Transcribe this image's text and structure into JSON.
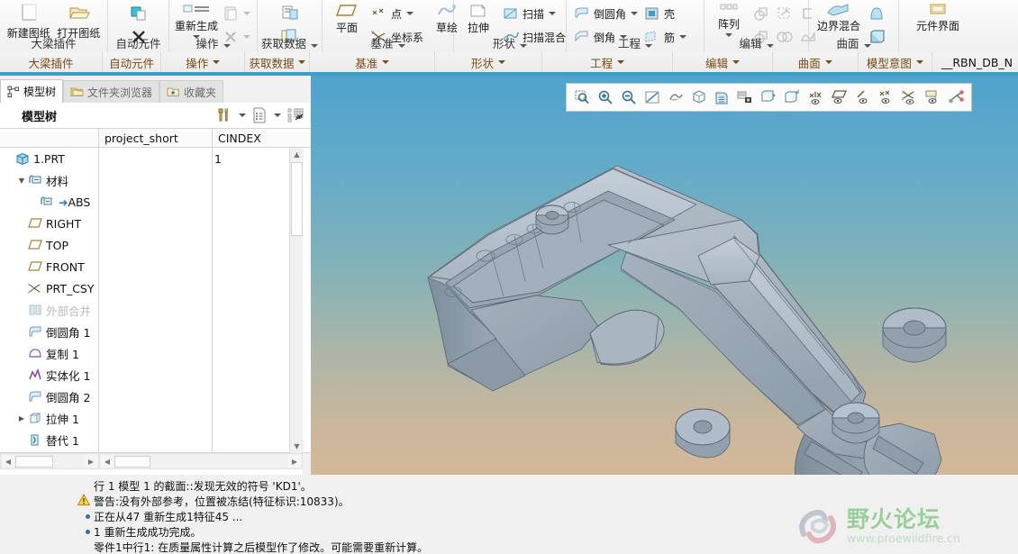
{
  "ribbon": {
    "groups": [
      {
        "name": "beam-plugin",
        "label": "大梁插件",
        "has_caret": false,
        "buttons": [
          {
            "name": "new-drawing",
            "label": "新建图纸",
            "icon": "new-sheet-icon"
          },
          {
            "name": "open-drawing",
            "label": "打开图纸",
            "icon": "open-sheet-icon"
          }
        ]
      },
      {
        "name": "auto-component",
        "label": "自动元件",
        "has_caret": false,
        "buttons": [
          {
            "name": "auto-create",
            "label": "",
            "icon": "auto-component-icon"
          },
          {
            "name": "auto-delete",
            "label": "",
            "icon": "x-icon"
          }
        ]
      },
      {
        "name": "operations",
        "label": "操作",
        "has_caret": true,
        "buttons": [
          {
            "name": "regenerate",
            "label": "重新生成",
            "icon": "regenerate-icon"
          },
          {
            "name": "paste",
            "label": "",
            "icon": "paste-icon"
          },
          {
            "name": "delete",
            "label": "",
            "icon": "x-icon"
          }
        ]
      },
      {
        "name": "get-data",
        "label": "获取数据",
        "has_caret": true,
        "buttons": [
          {
            "name": "import-data",
            "label": "",
            "icon": "import-icon"
          },
          {
            "name": "merge-data",
            "label": "",
            "icon": "merge-icon"
          }
        ]
      },
      {
        "name": "datum",
        "label": "基准",
        "has_caret": true,
        "buttons": [
          {
            "name": "plane",
            "label": "平面",
            "icon": "datum-plane-icon"
          },
          {
            "name": "point",
            "label": "点",
            "icon": "datum-point-icon"
          },
          {
            "name": "coordinate-system",
            "label": "坐标系",
            "icon": "csys-icon"
          },
          {
            "name": "sketch",
            "label": "草绘",
            "icon": "sketch-icon"
          }
        ]
      },
      {
        "name": "shapes",
        "label": "形状",
        "has_caret": true,
        "buttons": [
          {
            "name": "extrude",
            "label": "拉伸",
            "icon": "extrude-icon"
          },
          {
            "name": "sweep",
            "label": "扫描",
            "icon": "sweep-icon"
          },
          {
            "name": "swept-blend",
            "label": "扫描混合",
            "icon": "swept-blend-icon"
          }
        ]
      },
      {
        "name": "engineering",
        "label": "工程",
        "has_caret": true,
        "buttons": [
          {
            "name": "round",
            "label": "倒圆角",
            "icon": "round-icon"
          },
          {
            "name": "shell",
            "label": "壳",
            "icon": "shell-icon"
          },
          {
            "name": "chamfer",
            "label": "倒角",
            "icon": "chamfer-icon"
          },
          {
            "name": "rib",
            "label": "筋",
            "icon": "rib-icon"
          }
        ]
      },
      {
        "name": "editing",
        "label": "编辑",
        "has_caret": true,
        "buttons": [
          {
            "name": "pattern",
            "label": "阵列",
            "icon": "pattern-icon"
          },
          {
            "name": "mirror",
            "label": "",
            "icon": "mirror-icon"
          },
          {
            "name": "trim",
            "label": "",
            "icon": "trim-icon"
          },
          {
            "name": "offset",
            "label": "",
            "icon": "offset-icon"
          },
          {
            "name": "merge",
            "label": "",
            "icon": "merge-surface-icon"
          },
          {
            "name": "intersect",
            "label": "",
            "icon": "intersect-icon"
          },
          {
            "name": "project",
            "label": "",
            "icon": "project-icon"
          }
        ]
      },
      {
        "name": "surfaces",
        "label": "曲面",
        "has_caret": true,
        "buttons": [
          {
            "name": "boundary-blend",
            "label": "边界混合",
            "icon": "boundary-blend-icon"
          },
          {
            "name": "style",
            "label": "",
            "icon": "style-surface-icon"
          },
          {
            "name": "freestyle",
            "label": "",
            "icon": "freestyle-icon"
          }
        ]
      },
      {
        "name": "model-intent",
        "label": "模型意图",
        "has_caret": true,
        "buttons": [
          {
            "name": "component-interface",
            "label": "元件界面",
            "icon": "component-interface-icon"
          }
        ]
      }
    ],
    "tail_tab": "__RBN_DB_N"
  },
  "left_panel": {
    "nav_tabs": [
      {
        "name": "model-tree",
        "label": "模型树",
        "icon": "model-tree-icon",
        "active": true
      },
      {
        "name": "folder-browser",
        "label": "文件夹浏览器",
        "icon": "folder-icon",
        "active": false
      },
      {
        "name": "favorites",
        "label": "收藏夹",
        "icon": "favorites-folder-icon",
        "active": false
      }
    ],
    "header": {
      "title": "模型树",
      "tools": [
        {
          "name": "settings-tools-icon",
          "caret": true
        },
        {
          "name": "tree-columns-icon",
          "caret": true
        },
        {
          "name": "tree-filters-icon",
          "caret": false
        }
      ]
    },
    "columns": [
      "",
      "project_short",
      "CINDEX"
    ],
    "tree": [
      {
        "name": "part-root",
        "label": "1.PRT",
        "icon": "part-icon",
        "indent": 0,
        "arrow": "",
        "dim": false,
        "value": "",
        "cindex": "1"
      },
      {
        "name": "material-folder",
        "label": "材料",
        "icon": "material-icon",
        "indent": 1,
        "arrow": "down",
        "dim": false,
        "value": "",
        "cindex": ""
      },
      {
        "name": "material-abs",
        "label": "ABS",
        "icon": "material-arrow-icon",
        "indent": 2,
        "arrow": "",
        "dim": false,
        "value": "",
        "cindex": ""
      },
      {
        "name": "datum-right",
        "label": "RIGHT",
        "icon": "datum-plane-icon",
        "indent": 1,
        "arrow": "",
        "dim": false,
        "value": "",
        "cindex": ""
      },
      {
        "name": "datum-top",
        "label": "TOP",
        "icon": "datum-plane-icon",
        "indent": 1,
        "arrow": "",
        "dim": false,
        "value": "",
        "cindex": ""
      },
      {
        "name": "datum-front",
        "label": "FRONT",
        "icon": "datum-plane-icon",
        "indent": 1,
        "arrow": "",
        "dim": false,
        "value": "",
        "cindex": ""
      },
      {
        "name": "prt-csys",
        "label": "PRT_CSY",
        "icon": "csys-icon",
        "indent": 1,
        "arrow": "",
        "dim": false,
        "value": "",
        "cindex": ""
      },
      {
        "name": "external-merge",
        "label": "外部合并",
        "icon": "external-merge-icon",
        "indent": 1,
        "arrow": "",
        "dim": true,
        "value": "",
        "cindex": ""
      },
      {
        "name": "round-1",
        "label": "倒圆角 1",
        "icon": "round-icon",
        "indent": 1,
        "arrow": "",
        "dim": false,
        "value": "",
        "cindex": ""
      },
      {
        "name": "copy-1",
        "label": "复制 1",
        "icon": "copy-geom-icon",
        "indent": 1,
        "arrow": "",
        "dim": false,
        "value": "",
        "cindex": ""
      },
      {
        "name": "solidify-1",
        "label": "实体化 1",
        "icon": "solidify-icon",
        "indent": 1,
        "arrow": "",
        "dim": false,
        "value": "",
        "cindex": ""
      },
      {
        "name": "round-2",
        "label": "倒圆角 2",
        "icon": "round-icon",
        "indent": 1,
        "arrow": "",
        "dim": false,
        "value": "",
        "cindex": ""
      },
      {
        "name": "extrude-1",
        "label": "拉伸 1",
        "icon": "extrude-icon",
        "indent": 1,
        "arrow": "right",
        "dim": false,
        "value": "",
        "cindex": ""
      },
      {
        "name": "replace-1",
        "label": "替代 1",
        "icon": "replace-icon",
        "indent": 1,
        "arrow": "",
        "dim": false,
        "value": "",
        "cindex": ""
      }
    ]
  },
  "viewport": {
    "background_top": "#4fa3cd",
    "background_bottom": "#d3b898",
    "model_color": "#9aa8b4",
    "graphics_toolbar": [
      {
        "name": "zoom-window-icon"
      },
      {
        "name": "zoom-in-icon"
      },
      {
        "name": "zoom-out-icon"
      },
      {
        "name": "refit-icon"
      },
      {
        "name": "reorient-icon"
      },
      {
        "name": "saved-views-icon"
      },
      {
        "name": "view-manager-icon"
      },
      {
        "name": "named-view-camera-icon"
      },
      {
        "name": "display-style-icon"
      },
      {
        "name": "perspective-view-icon"
      },
      {
        "name": "datum-display-filter-icon"
      },
      {
        "name": "plane-display-icon"
      },
      {
        "name": "axis-display-icon"
      },
      {
        "name": "point-display-icon"
      },
      {
        "name": "csys-display-icon"
      },
      {
        "name": "annotation-display-icon"
      },
      {
        "name": "spin-center-icon"
      }
    ]
  },
  "messages": [
    {
      "name": "msg-error",
      "icon": "none",
      "text": "行 1 模型 1 的截面::发现无效的符号 'KD1'。"
    },
    {
      "name": "msg-warning",
      "icon": "warning",
      "text": "警告:没有外部参考，位置被冻结(特征标识:10833)。"
    },
    {
      "name": "msg-info-1",
      "icon": "bullet",
      "text": "正在从47 重新生成1特征45 ..."
    },
    {
      "name": "msg-info-2",
      "icon": "bullet",
      "text": "1 重新生成成功完成。"
    },
    {
      "name": "msg-info-3",
      "icon": "none",
      "text": "零件1中行1: 在质量属性计算之后模型作了修改。可能需要重新计算。"
    }
  ],
  "watermark": {
    "title": "野火论坛",
    "url": "www.proewildfire.cn",
    "color": "#5cb85c"
  }
}
